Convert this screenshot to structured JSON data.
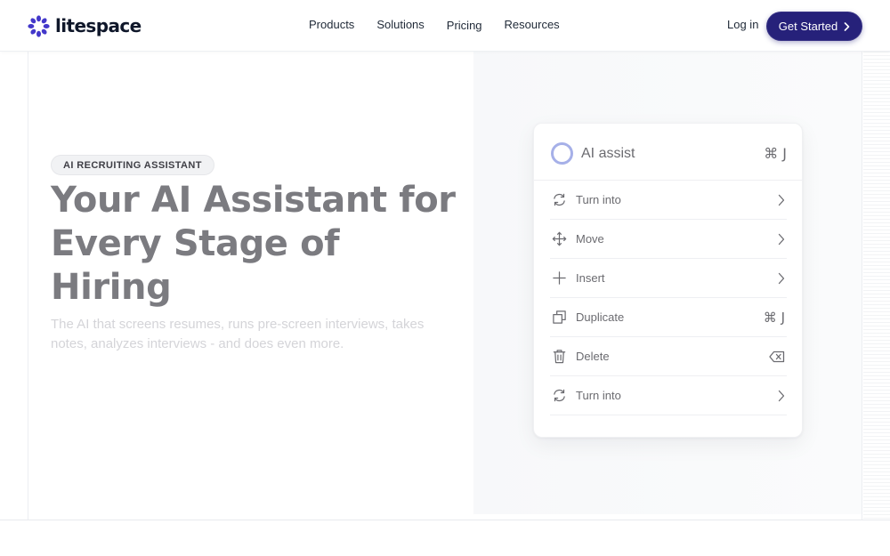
{
  "brand": {
    "name": "litespace"
  },
  "nav": {
    "items": [
      "Products",
      "Solutions",
      "Pricing",
      "Resources"
    ]
  },
  "header": {
    "login_label": "Log in",
    "cta_label": "Get Started"
  },
  "hero": {
    "badge": "AI RECRUITING ASSISTANT",
    "title": "Your AI Assistant for Every Stage of Hiring",
    "subtitle": "The AI that screens resumes, runs pre-screen interviews, takes notes, analyzes interviews - and does even more."
  },
  "menu": {
    "title": "AI assist",
    "shortcut": "⌘ J",
    "items": [
      {
        "label": "Turn into",
        "icon": "refresh-icon",
        "trailing": "chevron-right-icon"
      },
      {
        "label": "Move",
        "icon": "move-icon",
        "trailing": "chevron-right-icon"
      },
      {
        "label": "Insert",
        "icon": "plus-icon",
        "trailing": "chevron-right-icon"
      },
      {
        "label": "Duplicate",
        "icon": "duplicate-icon",
        "shortcut": "⌘ J"
      },
      {
        "label": "Delete",
        "icon": "trash-icon",
        "trailing": "backspace-icon"
      },
      {
        "label": "Turn into",
        "icon": "refresh-icon",
        "trailing": "chevron-right-icon"
      }
    ]
  },
  "colors": {
    "brand_primary": "#4338ca",
    "cta_background": "#26217a",
    "ring_accent": "#a6b0e8",
    "hero_title": "#7b7b80",
    "hero_subtitle": "#d4d4d8"
  }
}
